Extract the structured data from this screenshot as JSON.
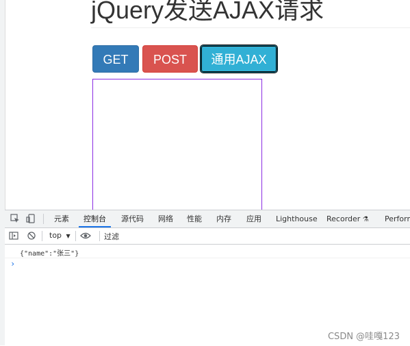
{
  "page": {
    "title": "jQuery发送AJAX请求",
    "buttons": {
      "get": "GET",
      "post": "POST",
      "ajax": "通用AJAX"
    }
  },
  "devtools": {
    "tabs": [
      "元素",
      "控制台",
      "源代码",
      "网络",
      "性能",
      "内存",
      "应用",
      "Lighthouse",
      "Recorder",
      "Perform"
    ],
    "active_tab": "控制台",
    "context": "top",
    "filter_placeholder": "过滤",
    "log": "{\"name\":\"张三\"}",
    "prompt": "›"
  },
  "watermark": "CSDN @哇嘎123",
  "colors": {
    "get": "#337ab7",
    "post": "#d9534f",
    "ajax": "#31b0d5",
    "result_border": "#8a2be2",
    "devtools_accent": "#1a73e8"
  }
}
